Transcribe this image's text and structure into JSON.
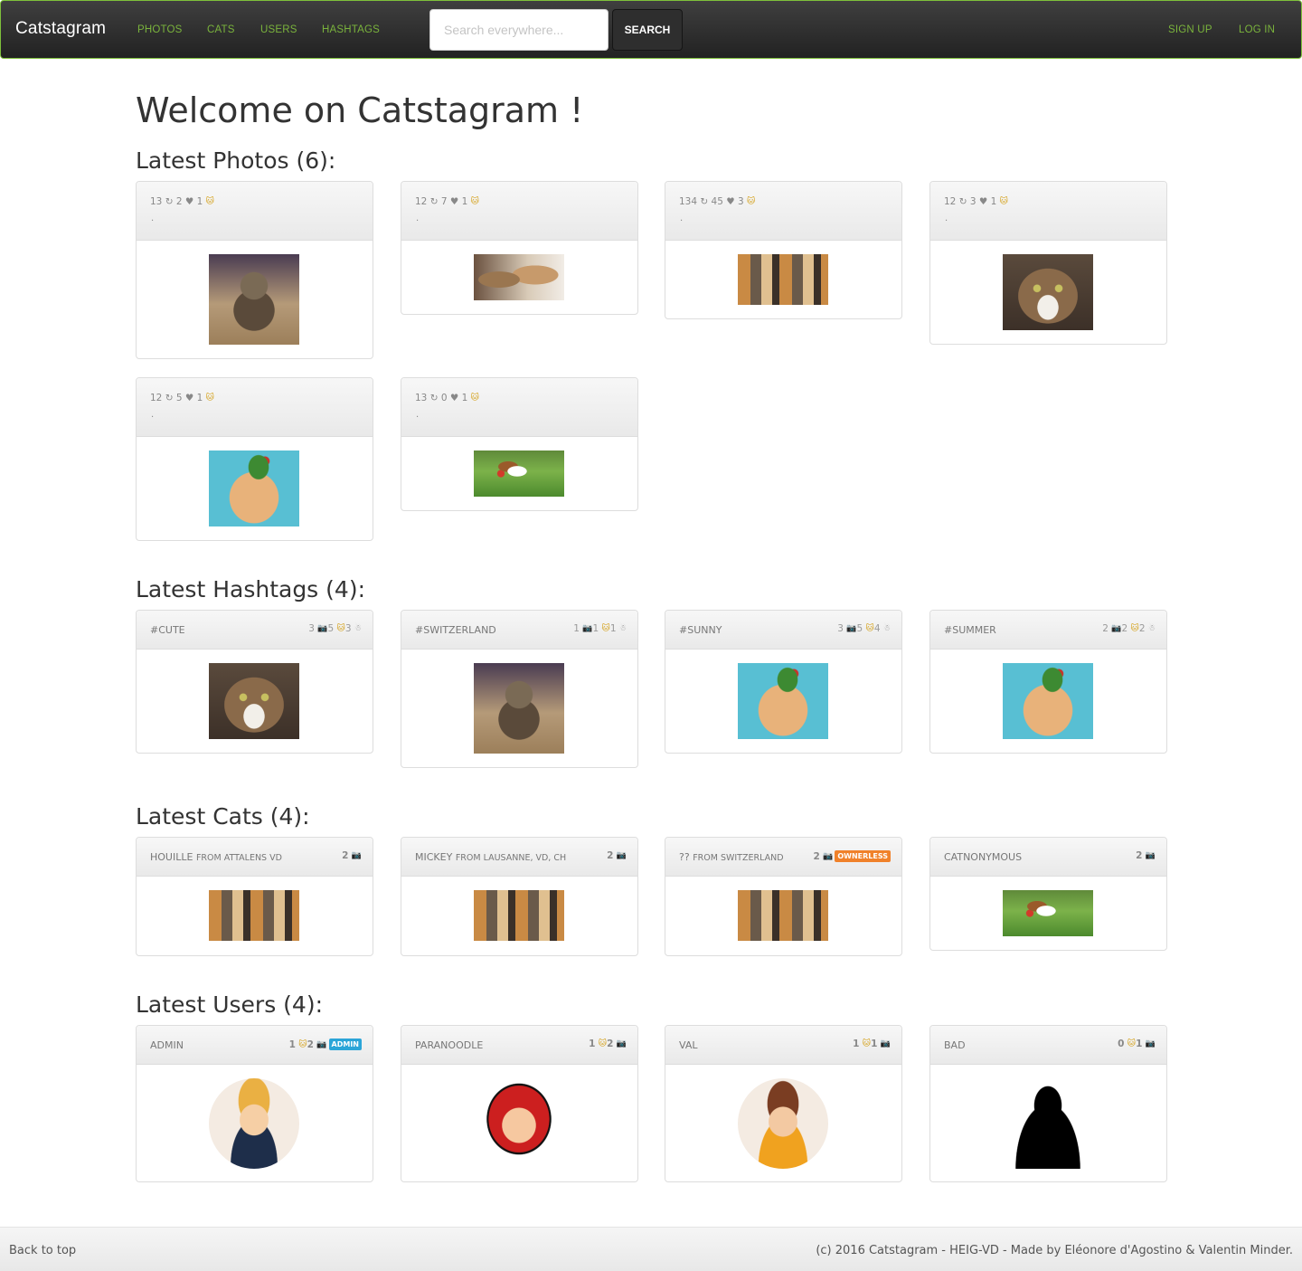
{
  "navbar": {
    "brand": "Catstagram",
    "links": [
      "PHOTOS",
      "CATS",
      "USERS",
      "HASHTAGS"
    ],
    "search_placeholder": "Search everywhere...",
    "search_button": "SEARCH",
    "signup": "SIGN UP",
    "login": "LOG IN",
    "accent_color": "#7ab33c"
  },
  "page_title": "Welcome on Catstagram !",
  "photos": {
    "title": "Latest Photos (6):",
    "items": [
      {
        "stats": "13 ↻ 2 ♥ 1",
        "caption": ".",
        "image": "kitten-bowtie"
      },
      {
        "stats": "12 ↻ 7 ♥ 1",
        "caption": ".",
        "image": "two-cats"
      },
      {
        "stats": "134 ↻ 45 ♥ 3",
        "caption": ".",
        "image": "cat-group"
      },
      {
        "stats": "12 ↻ 3 ♥ 1",
        "caption": ".",
        "image": "tabby-cat"
      },
      {
        "stats": "12 ↻ 5 ♥ 1",
        "caption": ".",
        "image": "cat-with-hat"
      },
      {
        "stats": "13 ↻ 0 ♥ 1",
        "caption": ".",
        "image": "beagle"
      }
    ]
  },
  "hashtags": {
    "title": "Latest Hashtags (4):",
    "items": [
      {
        "name": "#CUTE",
        "photos": "3",
        "cats": "5",
        "users": "3",
        "image": "tabby-cat"
      },
      {
        "name": "#SWITZERLAND",
        "photos": "1",
        "cats": "1",
        "users": "1",
        "image": "kitten-bowtie"
      },
      {
        "name": "#SUNNY",
        "photos": "3",
        "cats": "5",
        "users": "4",
        "image": "cat-with-hat"
      },
      {
        "name": "#SUMMER",
        "photos": "2",
        "cats": "2",
        "users": "2",
        "image": "cat-with-hat"
      }
    ]
  },
  "cats": {
    "title": "Latest Cats (4):",
    "items": [
      {
        "name": "HOUILLE",
        "from": "FROM ATTALENS VD",
        "count": "2",
        "badge": "",
        "image": "cat-group"
      },
      {
        "name": "MICKEY",
        "from": "FROM LAUSANNE, VD, CH",
        "count": "2",
        "badge": "",
        "image": "cat-group"
      },
      {
        "name": "??",
        "from": "FROM SWITZERLAND",
        "count": "2",
        "badge": "OWNERLESS",
        "image": "cat-group"
      },
      {
        "name": "CATNONYMOUS",
        "from": "",
        "count": "2",
        "badge": "",
        "image": "beagle"
      }
    ]
  },
  "users": {
    "title": "Latest Users (4):",
    "items": [
      {
        "name": "ADMIN",
        "cats": "1",
        "photos": "2",
        "badge": "ADMIN",
        "avatar": "businessman"
      },
      {
        "name": "PARANOODLE",
        "cats": "1",
        "photos": "2",
        "badge": "",
        "avatar": "red-hood-girl"
      },
      {
        "name": "VAL",
        "cats": "1",
        "photos": "1",
        "badge": "",
        "avatar": "young-man"
      },
      {
        "name": "BAD",
        "cats": "0",
        "photos": "1",
        "badge": "",
        "avatar": "silhouette"
      }
    ]
  },
  "footer": {
    "back_to_top": "Back to top",
    "copyright": "(c) 2016 Catstagram - HEIG-VD - Made by Eléonore d'Agostino & Valentin Minder."
  }
}
